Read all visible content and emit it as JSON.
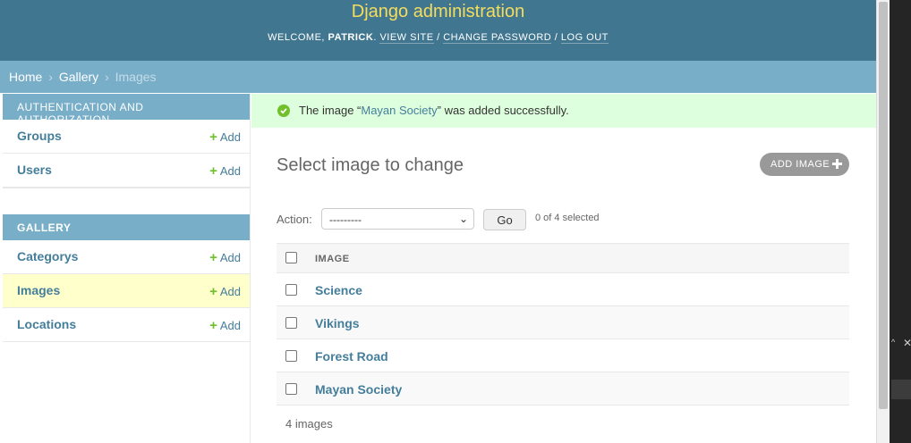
{
  "header": {
    "site_title": "Django administration",
    "welcome": "Welcome, ",
    "username": "Patrick",
    "view_site": "View site",
    "change_password": "Change password",
    "log_out": "Log out",
    "separator": " / "
  },
  "breadcrumbs": {
    "home": "Home",
    "gallery": "Gallery",
    "current": "Images",
    "separator": "›"
  },
  "sidebar": {
    "auth_caption": "Authentication and Authorization",
    "auth_items": [
      {
        "label": "Groups",
        "add": "Add"
      },
      {
        "label": "Users",
        "add": "Add"
      }
    ],
    "gallery_caption": "Gallery",
    "gallery_items": [
      {
        "label": "Categorys",
        "add": "Add"
      },
      {
        "label": "Images",
        "add": "Add",
        "current": true
      },
      {
        "label": "Locations",
        "add": "Add"
      }
    ]
  },
  "message": {
    "prefix": "The image “",
    "link": "Mayan Society",
    "suffix": "” was added successfully."
  },
  "content": {
    "title": "Select image to change",
    "add_button": "Add image",
    "action_label": "Action:",
    "action_selected": "---------",
    "go_button": "Go",
    "selected_count": "0 of 4 selected",
    "column_header": "Image",
    "rows": [
      "Science",
      "Vikings",
      "Forest Road",
      "Mayan Society"
    ],
    "paginator": "4 images"
  },
  "colors": {
    "header_bg": "#417690",
    "site_title": "#f5dd5d",
    "breadcrumbs_bg": "#79aec8",
    "link": "#447e9b",
    "success_bg": "#ddffdd",
    "add_plus": "#70bf2b"
  }
}
